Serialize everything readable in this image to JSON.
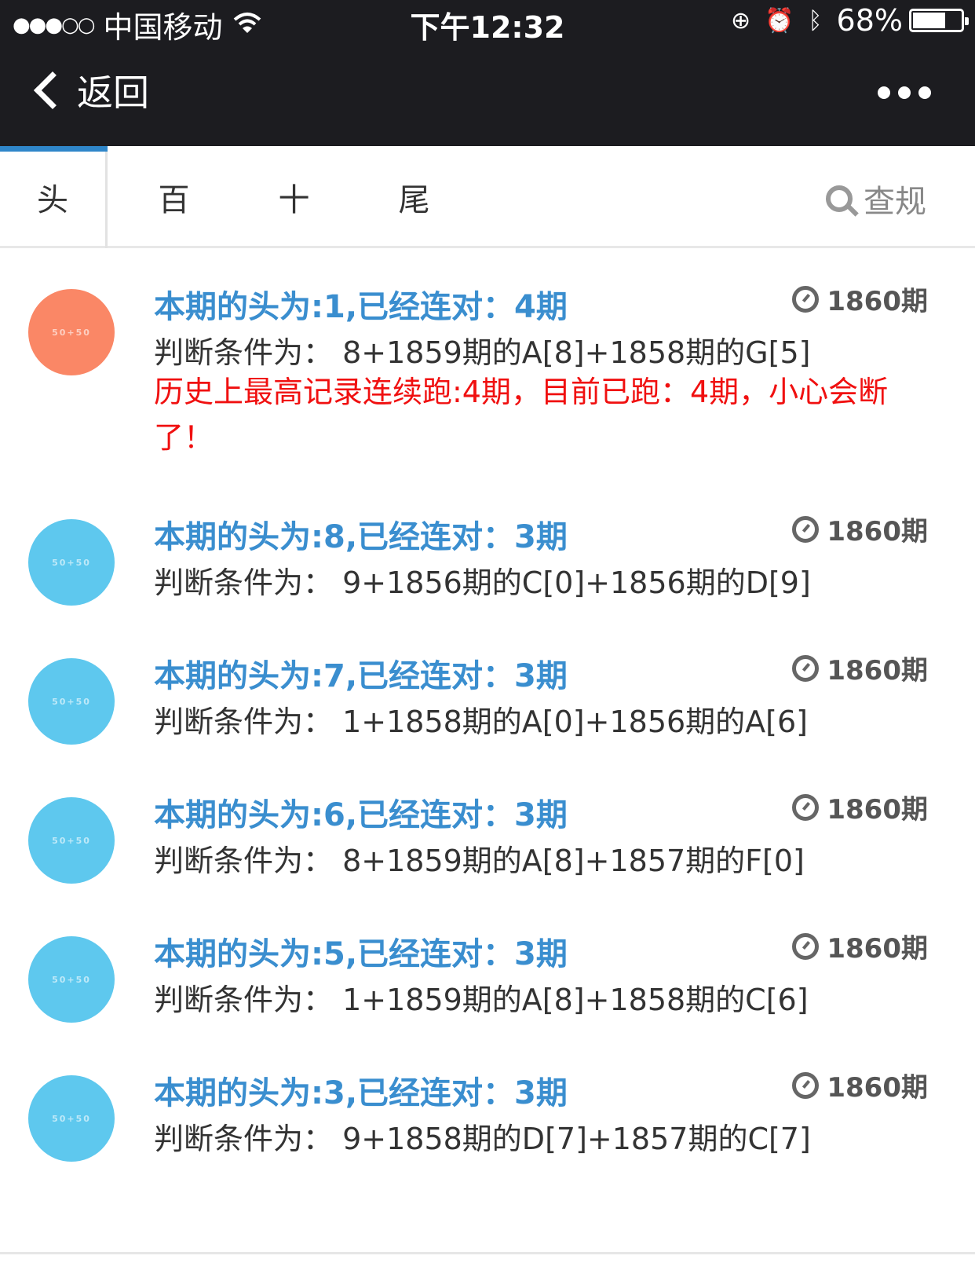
{
  "status_bar": {
    "signal": "●●●○○",
    "carrier": "中国移动",
    "wifi_icon": "wifi-icon",
    "time": "下午12:32",
    "battery_percent": "68%",
    "battery_level": 0.68
  },
  "nav": {
    "back_label": "返回"
  },
  "tabs": {
    "items": [
      "头",
      "百",
      "十",
      "尾"
    ],
    "active_index": 0,
    "search_label": "查规"
  },
  "colors": {
    "accent": "#3a8ecf",
    "warning": "#f01010",
    "avatar_alert": "#fa8766",
    "avatar_normal": "#5ec8ee"
  },
  "avatar_text": "50+50",
  "items": [
    {
      "title": "本期的头为:1,已经连对：4期",
      "condition": "判断条件为： 8+1859期的A[8]+1858期的G[5]",
      "warning": "历史上最高记录连续跑:4期，目前已跑：4期，小心会断了！",
      "issue": "1860期",
      "alert": true
    },
    {
      "title": "本期的头为:8,已经连对：3期",
      "condition": "判断条件为： 9+1856期的C[0]+1856期的D[9]",
      "issue": "1860期",
      "alert": false
    },
    {
      "title": "本期的头为:7,已经连对：3期",
      "condition": "判断条件为： 1+1858期的A[0]+1856期的A[6]",
      "issue": "1860期",
      "alert": false
    },
    {
      "title": "本期的头为:6,已经连对：3期",
      "condition": "判断条件为： 8+1859期的A[8]+1857期的F[0]",
      "issue": "1860期",
      "alert": false
    },
    {
      "title": "本期的头为:5,已经连对：3期",
      "condition": "判断条件为： 1+1859期的A[8]+1858期的C[6]",
      "issue": "1860期",
      "alert": false
    },
    {
      "title": "本期的头为:3,已经连对：3期",
      "condition": "判断条件为： 9+1858期的D[7]+1857期的C[7]",
      "issue": "1860期",
      "alert": false
    }
  ]
}
